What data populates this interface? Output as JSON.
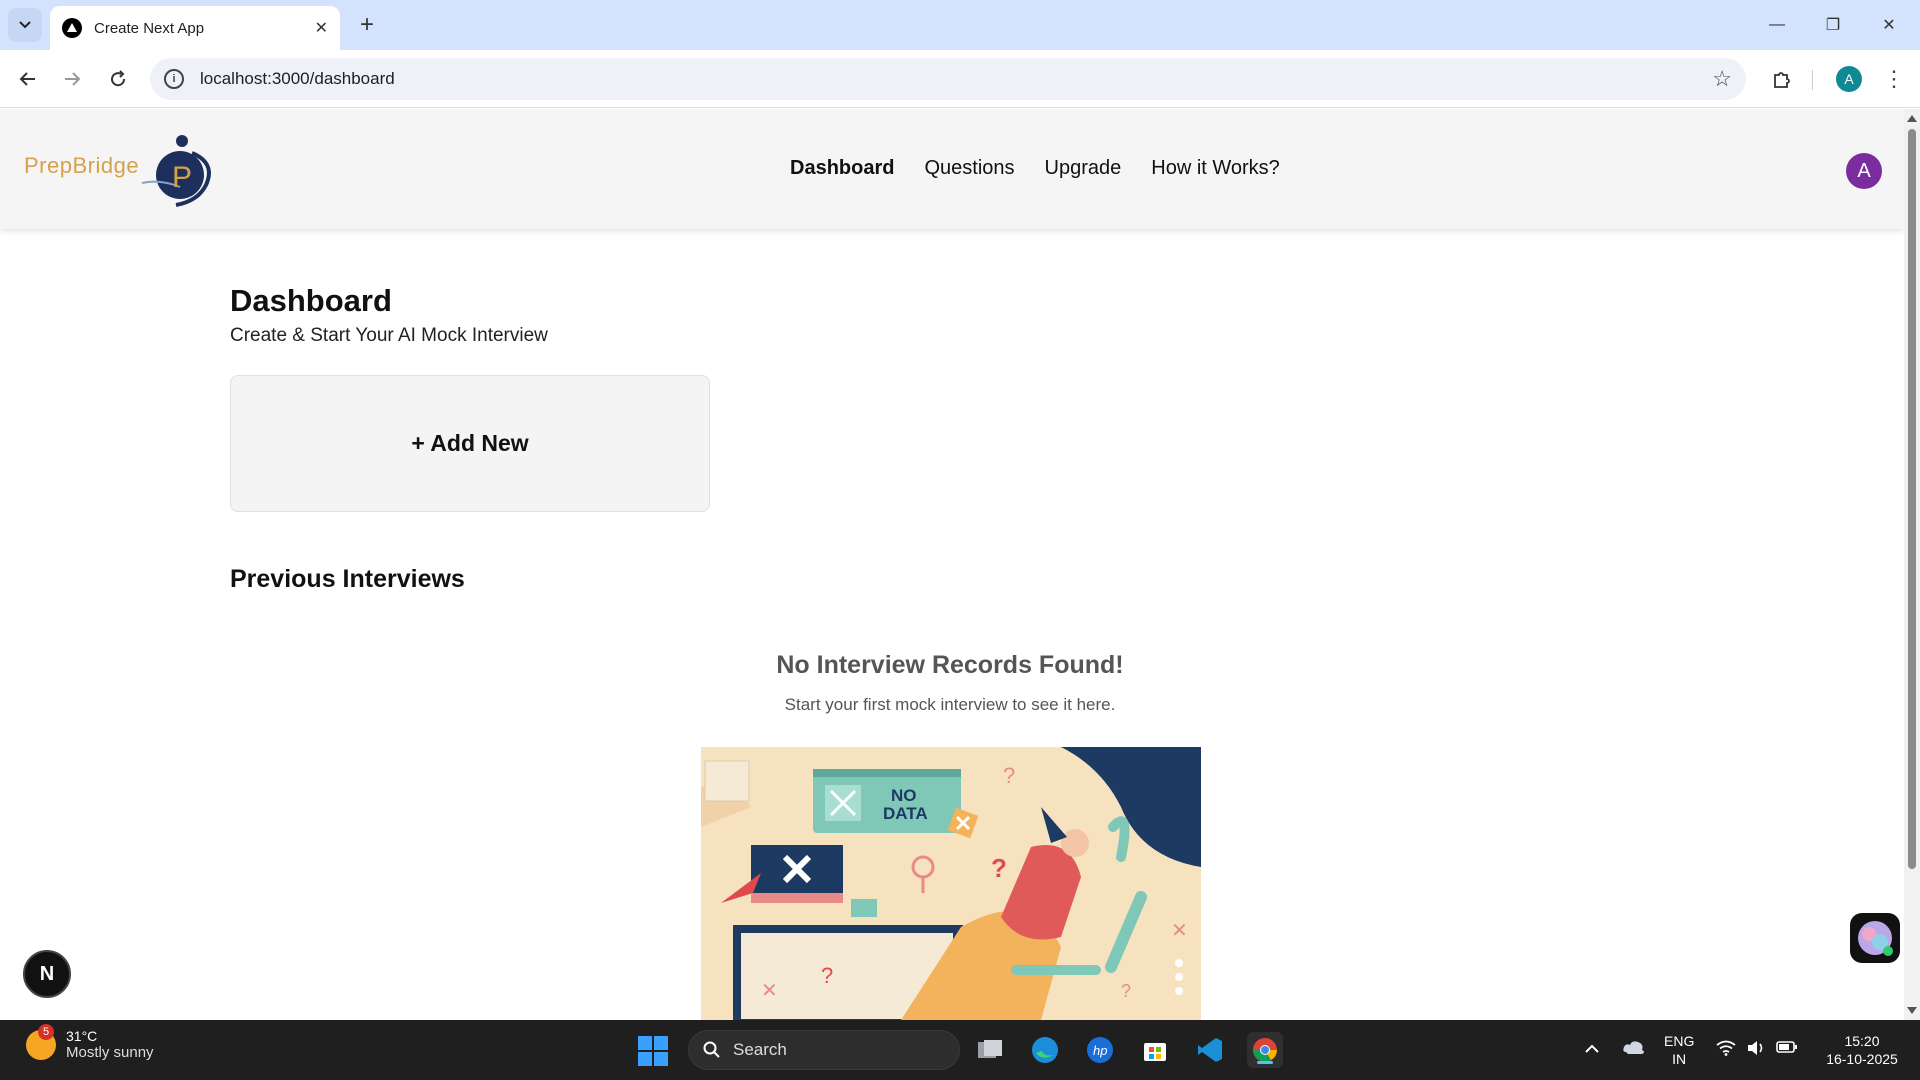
{
  "browser": {
    "tab_title": "Create Next App",
    "url": "localhost:3000/dashboard",
    "profile_initial": "A"
  },
  "app": {
    "logo_text": "PrepBridge",
    "logo_letter": "P",
    "nav": [
      "Dashboard",
      "Questions",
      "Upgrade",
      "How it Works?"
    ],
    "active_nav": "Dashboard",
    "user_initial": "A"
  },
  "dashboard": {
    "title": "Dashboard",
    "subtitle": "Create & Start Your AI Mock Interview",
    "add_new_label": "+ Add New",
    "previous_title": "Previous Interviews",
    "empty_title": "No Interview Records Found!",
    "empty_subtitle": "Start your first mock interview to see it here.",
    "illustration_text_line1": "NO",
    "illustration_text_line2": "DATA"
  },
  "overlays": {
    "next_badge": "N"
  },
  "taskbar": {
    "weather_badge": "5",
    "temperature": "31°C",
    "weather_desc": "Mostly sunny",
    "search_label": "Search",
    "lang_line1": "ENG",
    "lang_line2": "IN",
    "time": "15:20",
    "date": "16-10-2025"
  },
  "colors": {
    "logo": "#d4a24a",
    "logo_mark": "#1d2f5c",
    "avatar": "#7b2c9e",
    "header_bg": "#f5f5f5",
    "browser_frame": "#d3e3fd"
  }
}
